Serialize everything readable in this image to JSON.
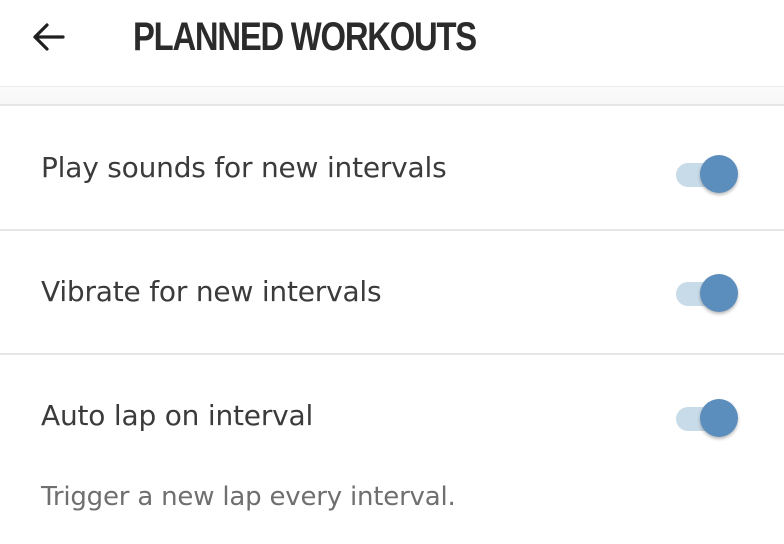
{
  "header": {
    "title": "PLANNED WORKOUTS",
    "back_icon": "arrow-left-icon"
  },
  "settings": [
    {
      "label": "Play sounds for new intervals",
      "enabled": true
    },
    {
      "label": "Vibrate for new intervals",
      "enabled": true
    },
    {
      "label": "Auto lap on interval",
      "enabled": true,
      "description": "Trigger a new lap every interval."
    }
  ],
  "colors": {
    "toggle_on_thumb": "#5b8dbd",
    "toggle_on_track": "#c8dbe9",
    "title_text": "#2b2b2b",
    "label_text": "#3b3b3b",
    "description_text": "#6f6f6f"
  }
}
